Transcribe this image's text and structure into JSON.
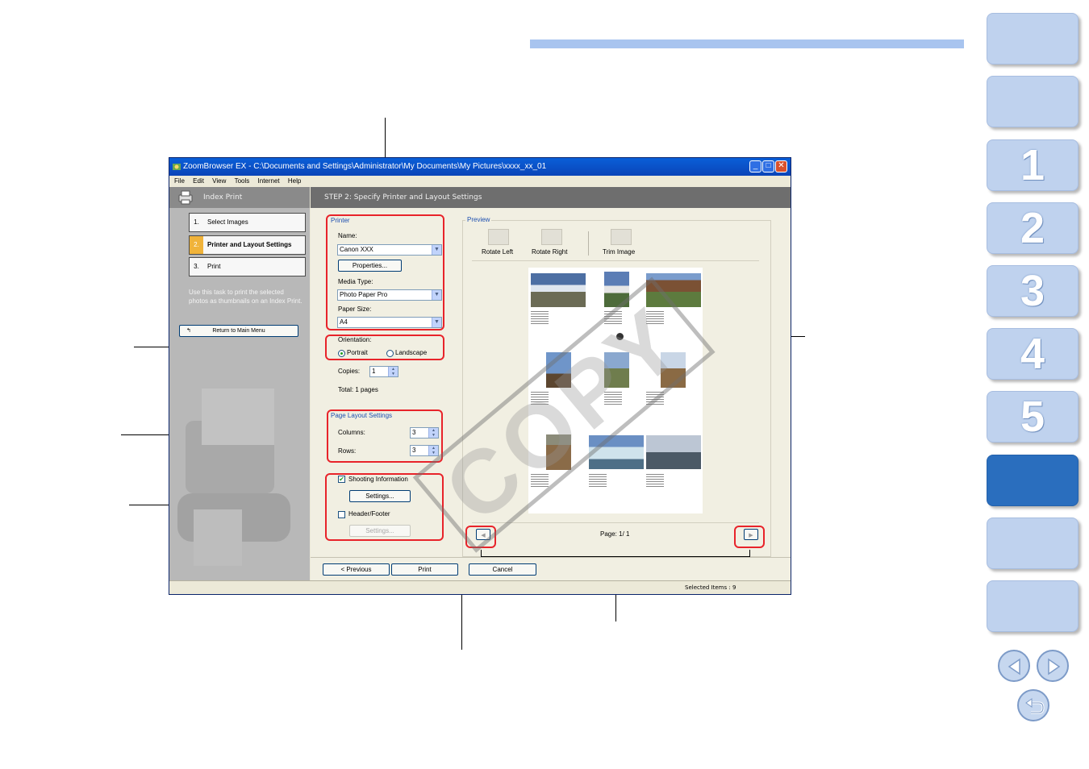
{
  "window": {
    "title": "ZoomBrowser EX  -  C:\\Documents and Settings\\Administrator\\My Documents\\My Pictures\\xxxx_xx_01",
    "menu": [
      "File",
      "Edit",
      "View",
      "Tools",
      "Internet",
      "Help"
    ]
  },
  "left_panel": {
    "header": "Index Print",
    "steps": [
      {
        "num": "1.",
        "label": "Select Images"
      },
      {
        "num": "2.",
        "label": "Printer and Layout Settings"
      },
      {
        "num": "3.",
        "label": "Print"
      }
    ],
    "description": "Use this task to print the selected photos as thumbnails on an Index Print.",
    "return_label": "Return to Main Menu"
  },
  "main": {
    "header": "STEP 2: Specify Printer and Layout Settings",
    "printer": {
      "group_label": "Printer",
      "name_label": "Name:",
      "name_value": "Canon XXX",
      "properties_label": "Properties...",
      "media_type_label": "Media Type:",
      "media_type_value": "Photo Paper Pro",
      "paper_size_label": "Paper Size:",
      "paper_size_value": "A4"
    },
    "orientation": {
      "label": "Orientation:",
      "portrait": "Portrait",
      "landscape": "Landscape",
      "selected": "Portrait"
    },
    "copies": {
      "label": "Copies:",
      "value": "1"
    },
    "total": "Total: 1 pages",
    "page_layout": {
      "group_label": "Page Layout Settings",
      "columns_label": "Columns:",
      "columns_value": "3",
      "rows_label": "Rows:",
      "rows_value": "3"
    },
    "shooting_info": {
      "label": "Shooting Information",
      "checked": true,
      "settings": "Settings..."
    },
    "header_footer": {
      "label": "Header/Footer",
      "checked": false,
      "settings": "Settings..."
    },
    "preview": {
      "group_label": "Preview",
      "rotate_left": "Rotate Left",
      "rotate_right": "Rotate Right",
      "trim_image": "Trim Image",
      "page_label": "Page: 1/ 1"
    },
    "buttons": {
      "previous": "< Previous",
      "print": "Print",
      "cancel": "Cancel"
    }
  },
  "statusbar": {
    "selected": "Selected Items : 9"
  },
  "watermark": "COPY",
  "nav": {
    "tabs": [
      "",
      "",
      "1",
      "2",
      "3",
      "4",
      "5",
      "",
      ""
    ],
    "active_index": 6
  },
  "colors": {
    "nav_tab": "#bfd2ee",
    "nav_active": "#2a6ebe",
    "callout_red": "#e8232a",
    "top_bar": "#a8c4ef"
  }
}
